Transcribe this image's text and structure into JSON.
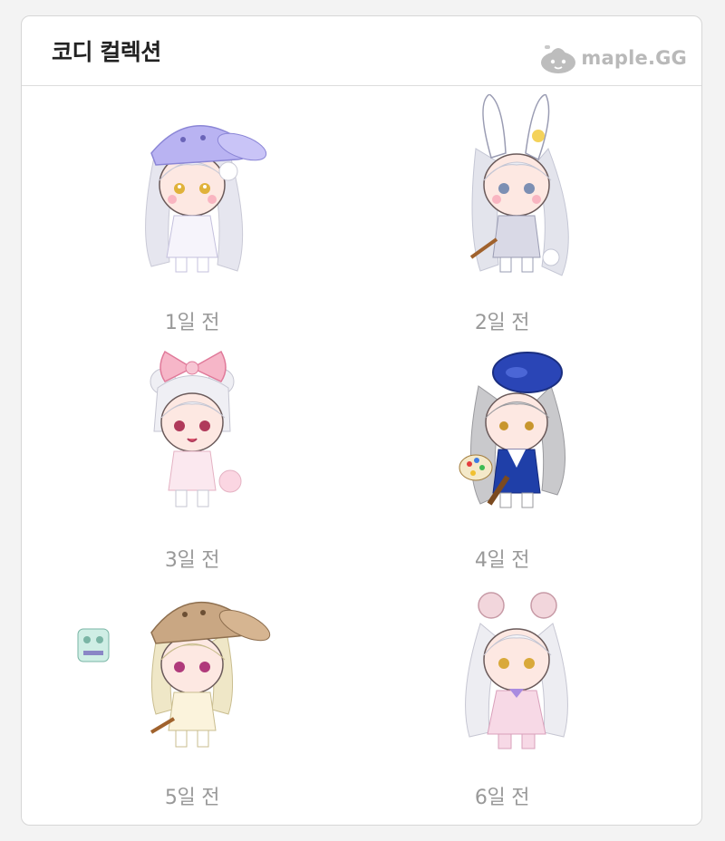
{
  "card": {
    "title": "코디 컬렉션",
    "brand": "maple.GG",
    "brand_icon": "slime-mascot-icon"
  },
  "collection": [
    {
      "label": "1일 전",
      "hat": "bunny-hood",
      "hat_color": "#b9b3f2",
      "hair_color": "#e6e6ef"
    },
    {
      "label": "2일 전",
      "hat": "bunny-ears",
      "hat_color": "#ffffff",
      "hair_color": "#e3e4ec"
    },
    {
      "label": "3일 전",
      "hat": "pink-ribbon",
      "hat_color": "#f6b6c8",
      "hair_color": "#efeff4"
    },
    {
      "label": "4일 전",
      "hat": "blue-beret",
      "hat_color": "#2a45b6",
      "hair_color": "#c9c9cc"
    },
    {
      "label": "5일 전",
      "hat": "tan-bunny-hood",
      "hat_color": "#c9a783",
      "hair_color": "#efe7c7"
    },
    {
      "label": "6일 전",
      "hat": "mouse-ears",
      "hat_color": "#f2d6dc",
      "hair_color": "#ededf2"
    }
  ]
}
